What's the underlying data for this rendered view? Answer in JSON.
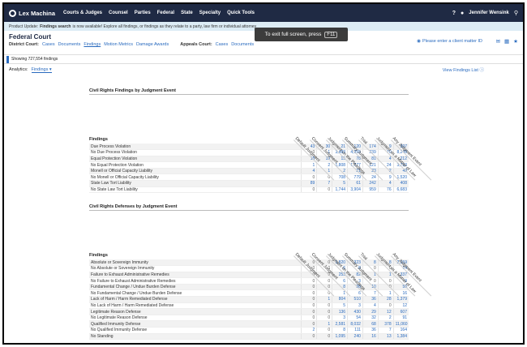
{
  "topnav": {
    "brand": "Lex Machina",
    "items": [
      "Courts & Judges",
      "Counsel",
      "Parties",
      "Federal",
      "State",
      "Specialty",
      "Quick Tools"
    ],
    "user": "Jennifer Wensink"
  },
  "toast": {
    "text": "To exit full screen, press",
    "key": "F11"
  },
  "update": {
    "prefix": "Product Update:",
    "bold": "Findings search",
    "text": "is now available! Explore all findings, or findings as they relate to a party, law firm or individual attorney"
  },
  "court": {
    "title": "Federal Court",
    "district_label": "District Court:",
    "district_links": [
      "Cases",
      "Documents",
      "Findings",
      "Motion Metrics",
      "Damage Awards"
    ],
    "appeals_label": "Appeals Court:",
    "appeals_links": [
      "Cases",
      "Documents"
    ],
    "client_matter": "Please enter a client matter ID"
  },
  "showing": "Showing 727,554 findings",
  "analytics": {
    "label": "Analytics:",
    "dropdown": "Findings ▾",
    "view_list": "View Findings List"
  },
  "columns": [
    "Default Judgment",
    "Consent Judgment",
    "Judgment on the Pleadings",
    "Summary Judgment",
    "Trial",
    "Judgment as a Matter of Law",
    "Any Judgment Event"
  ],
  "table1": {
    "title": "Civil Rights Findings by Judgment Event",
    "findings_label": "Findings",
    "rows": [
      {
        "name": "Due Process Violation",
        "values": [
          "43",
          "30",
          "21",
          "120",
          "174",
          "9",
          "397"
        ]
      },
      {
        "name": "No Due Process Violation",
        "values": [
          "0",
          "1",
          "3,483",
          "4,355",
          "339",
          "70",
          "8,248"
        ]
      },
      {
        "name": "Equal Protection Violation",
        "values": [
          "15",
          "19",
          "15",
          "78",
          "81",
          "4",
          "212"
        ]
      },
      {
        "name": "No Equal Protection Violation",
        "values": [
          "1",
          "2",
          "1,808",
          "1,777",
          "121",
          "24",
          "3,733"
        ]
      },
      {
        "name": "Monell or Official Capacity Liability",
        "values": [
          "4",
          "1",
          "2",
          "21",
          "23",
          "2",
          "49"
        ]
      },
      {
        "name": "No Monell or Official Capacity Liability",
        "values": [
          "0",
          "0",
          "708",
          "779",
          "24",
          "9",
          "1,520"
        ]
      },
      {
        "name": "State Law Tort Liability",
        "values": [
          "89",
          "7",
          "5",
          "61",
          "242",
          "4",
          "408"
        ]
      },
      {
        "name": "No State Law Tort Liability",
        "values": [
          "0",
          "0",
          "1,744",
          "3,904",
          "959",
          "76",
          "6,683"
        ]
      }
    ]
  },
  "table2": {
    "title": "Civil Rights Defenses by Judgment Event",
    "findings_label": "Findings",
    "rows": [
      {
        "name": "Absolute or Sovereign Immunity",
        "values": [
          "0",
          "0",
          "1,820",
          "323",
          "8",
          "8",
          "2,159"
        ]
      },
      {
        "name": "No Absolute or Sovereign Immunity",
        "values": [
          "0",
          "0",
          "6",
          "8",
          "0",
          "0",
          "14"
        ]
      },
      {
        "name": "Failure to Exhaust Administrative Remedies",
        "values": [
          "0",
          "0",
          "253",
          "82",
          "1",
          "1",
          "337"
        ]
      },
      {
        "name": "No Failure to Exhaust Administrative Remedies",
        "values": [
          "0",
          "0",
          "6",
          "3",
          "0",
          "0",
          "9"
        ]
      },
      {
        "name": "Fundamental Change / Undue Burden Defense",
        "values": [
          "0",
          "0",
          "8",
          "38",
          "10",
          "0",
          "56"
        ]
      },
      {
        "name": "No Fundamental Change / Undue Burden Defense",
        "values": [
          "0",
          "0",
          "1",
          "6",
          "7",
          "1",
          "16"
        ]
      },
      {
        "name": "Lack of Harm / Harm Remediated Defense",
        "values": [
          "0",
          "1",
          "804",
          "510",
          "36",
          "28",
          "1,379"
        ]
      },
      {
        "name": "No Lack of Harm / Harm Remediated Defense",
        "values": [
          "0",
          "0",
          "5",
          "3",
          "4",
          "0",
          "12"
        ]
      },
      {
        "name": "Legitimate Reason Defense",
        "values": [
          "0",
          "0",
          "136",
          "430",
          "29",
          "12",
          "607"
        ]
      },
      {
        "name": "No Legitimate Reason Defense",
        "values": [
          "0",
          "0",
          "3",
          "54",
          "32",
          "2",
          "91"
        ]
      },
      {
        "name": "Qualified Immunity Defense",
        "values": [
          "0",
          "1",
          "2,581",
          "8,032",
          "68",
          "378",
          "11,060"
        ]
      },
      {
        "name": "No Qualified Immunity Defense",
        "values": [
          "2",
          "0",
          "8",
          "111",
          "36",
          "7",
          "164"
        ]
      },
      {
        "name": "No Standing",
        "values": [
          "0",
          "0",
          "1,095",
          "240",
          "16",
          "13",
          "1,384"
        ]
      }
    ]
  }
}
